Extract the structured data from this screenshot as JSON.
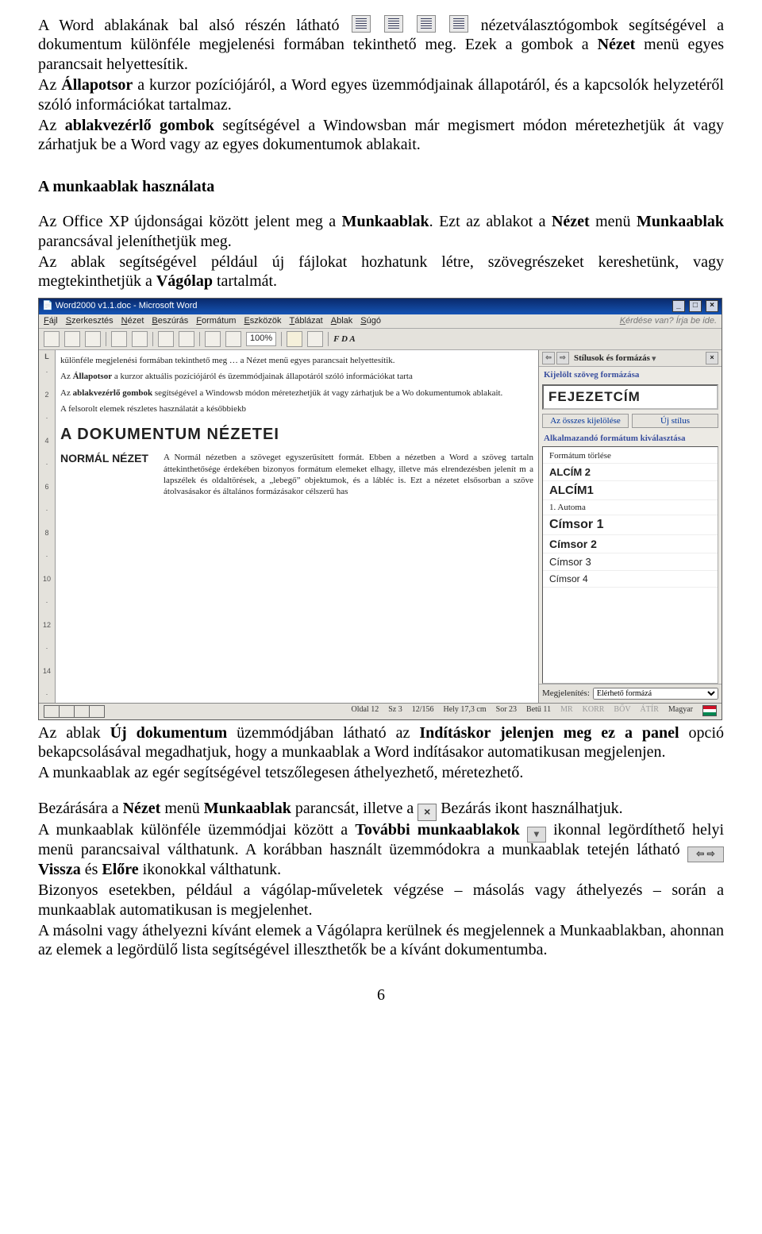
{
  "para1": {
    "t1": "A Word ablakának bal alsó részén látható ",
    "t2": " nézetválasztógombok segítségével a dokumentum különféle megjelenési formában tekinthető meg. Ezek a gombok a ",
    "b1": "Nézet",
    "t3": " menü egyes parancsait helyettesítik."
  },
  "para2": {
    "t1": "Az ",
    "b1": "Állapotsor",
    "t2": " a kurzor pozíciójáról, a Word egyes üzemmódjainak állapotáról, és a kapcsolók helyzetéről szóló információkat tartalmaz."
  },
  "para3": {
    "t1": "Az ",
    "b1": "ablakvezérlő gombok",
    "t2": " segítségével a Windowsban már megismert módon méretezhetjük át vagy zárhatjuk be a Word vagy az egyes dokumentumok ablakait."
  },
  "h1": "A munkaablak használata",
  "para4": {
    "t1": "Az Office XP újdonságai között jelent meg a ",
    "b1": "Munkaablak",
    "t2": ". Ezt az ablakot a ",
    "b2": "Nézet",
    "t3": " menü ",
    "b3": "Munkaablak",
    "t4": " parancsával jeleníthetjük meg."
  },
  "para5": {
    "t1": "Az ablak segítségével például új fájlokat hozhatunk létre, szövegrészeket kereshetünk, vagy megtekinthetjük a ",
    "b1": "Vágólap",
    "t2": " tartalmát."
  },
  "para6": {
    "t1": "Az ablak ",
    "b1": "Új dokumentum",
    "t2": " üzemmódjában látható az ",
    "b2": "Indításkor jelenjen meg ez a panel",
    "t3": " opció bekapcsolásával megadhatjuk, hogy a munkaablak a Word indításakor automatikusan megjelenjen."
  },
  "para7": "A munkaablak az egér segítségével tetszőlegesen áthelyezhető, méretezhető.",
  "para8": {
    "t1": "Bezárására a ",
    "b1": "Nézet",
    "t2": " menü ",
    "b2": "Munkaablak",
    "t3": " parancsát, illetve a ",
    "t4": " Bezárás ikont használhatjuk."
  },
  "para9": {
    "t1": "A munkaablak különféle üzemmódjai között a ",
    "b1": "További munkaablakok",
    "t2": " ikonnal legördíthető helyi menü parancsaival válthatunk. A korábban használt üzemmódokra a munkaablak tetején látható ",
    "b2": "Vissza",
    "t3": " és ",
    "b3": "Előre",
    "t4": " ikonokkal válthatunk."
  },
  "para10": "Bizonyos esetekben, például a vágólap-műveletek végzése – másolás vagy áthelyezés – során a munkaablak automatikusan is megjelenhet.",
  "para11": "A másolni vagy áthelyezni kívánt elemek a Vágólapra kerülnek és megjelennek a Munkaablakban, ahonnan az elemek a legördülő lista segítségével illeszthetők be a kívánt dokumentumba.",
  "pagenum": "6",
  "shot": {
    "title": "Word2000 v1.1.doc - Microsoft Word",
    "menu": [
      "Fájl",
      "Szerkesztés",
      "Nézet",
      "Beszúrás",
      "Formátum",
      "Eszközök",
      "Táblázat",
      "Ablak",
      "Súgó"
    ],
    "ask": "Kérdése van? Írja be ide.",
    "zoom": "100%",
    "fontAbbr": "F D A",
    "doc": {
      "p1": "különféle megjelenési formában tekinthető meg … a Nézet menü egyes parancsait helyettesítik.",
      "p2a": "Az ",
      "p2b": "Állapotsor",
      "p2c": " a kurzor aktuális pozíciójáról és üzemmódjainak állapotáról szóló információkat tarta",
      "p3a": "Az ",
      "p3b": "ablakvezérlő gombok",
      "p3c": " segítségével a Windowsb módon méretezhetjük át vagy zárhatjuk be a Wo dokumentumok ablakait.",
      "p4": "A felsorolt elemek részletes használatát a későbbiekb",
      "h1": "A DOKUMENTUM NÉZETEI",
      "h2": "NORMÁL NÉZET",
      "p5": "A Normál nézetben a szöveget egyszerűsített formát. Ebben a nézetben a Word a szöveg tartaln áttekinthetősége érdekében bizonyos formátum elemeket elhagy, illetve más elrendezésben jelenít m a lapszélek és oldaltörések, a „lebegő” objektumok, és a lábléc is. Ezt a nézetet elsősorban a szöve átolvasásakor és általános formázásakor célszerű has"
    },
    "task": {
      "title": "Stílusok és formázás",
      "sec1": "Kijelölt szöveg formázása",
      "current": "FEJEZETCÍM",
      "btn1": "Az összes kijelölése",
      "btn2": "Új stílus",
      "sec2": "Alkalmazandó formátum kiválasztása",
      "styles": [
        {
          "n": "Formátum törlése",
          "f": "11px Tahoma"
        },
        {
          "n": "ALCÍM 2",
          "f": "700 13px Arial"
        },
        {
          "n": "ALCÍM1",
          "f": "700 15px Arial"
        },
        {
          "n": "1.  Automa",
          "f": "11px Times"
        },
        {
          "n": "Címsor 1",
          "f": "700 16px Arial"
        },
        {
          "n": "Címsor 2",
          "f": "700 14px Arial"
        },
        {
          "n": "Címsor 3",
          "f": "13px Arial"
        },
        {
          "n": "Címsor 4",
          "f": "12px Arial"
        }
      ],
      "footLabel": "Megjelenítés:",
      "footSel": "Elérhető formázá"
    },
    "status": {
      "page": "Oldal 12",
      "sect": "Sz 3",
      "pg": "12/156",
      "pos": "Hely 17,3 cm",
      "line": "Sor 23",
      "col": "Betű 11",
      "g1": "MR",
      "g2": "KORR",
      "g3": "BŐV",
      "g4": "ÁTÍR",
      "lang": "Magyar"
    }
  }
}
